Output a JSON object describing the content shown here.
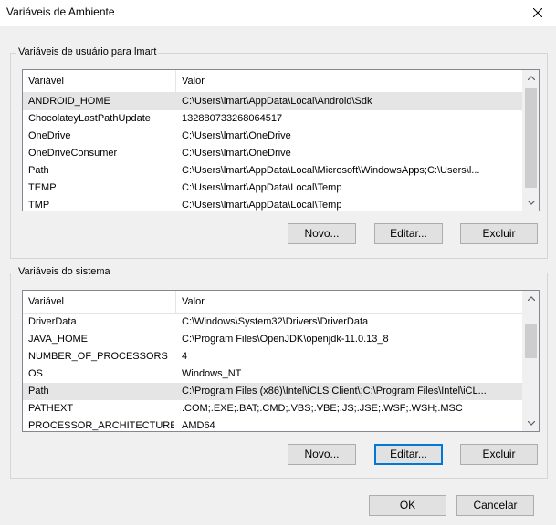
{
  "window": {
    "title": "Variáveis de Ambiente"
  },
  "user_group": {
    "legend": "Variáveis de usuário para lmart",
    "columns": [
      "Variável",
      "Valor"
    ],
    "rows": [
      {
        "name": "ANDROID_HOME",
        "value": "C:\\Users\\lmart\\AppData\\Local\\Android\\Sdk",
        "selected": true
      },
      {
        "name": "ChocolateyLastPathUpdate",
        "value": "132880733268064517"
      },
      {
        "name": "OneDrive",
        "value": "C:\\Users\\lmart\\OneDrive"
      },
      {
        "name": "OneDriveConsumer",
        "value": "C:\\Users\\lmart\\OneDrive"
      },
      {
        "name": "Path",
        "value": "C:\\Users\\lmart\\AppData\\Local\\Microsoft\\WindowsApps;C:\\Users\\l..."
      },
      {
        "name": "TEMP",
        "value": "C:\\Users\\lmart\\AppData\\Local\\Temp"
      },
      {
        "name": "TMP",
        "value": "C:\\Users\\lmart\\AppData\\Local\\Temp"
      }
    ],
    "buttons": {
      "new": "Novo...",
      "edit": "Editar...",
      "delete": "Excluir"
    }
  },
  "system_group": {
    "legend": "Variáveis do sistema",
    "columns": [
      "Variável",
      "Valor"
    ],
    "rows": [
      {
        "name": "DriverData",
        "value": "C:\\Windows\\System32\\Drivers\\DriverData"
      },
      {
        "name": "JAVA_HOME",
        "value": "C:\\Program Files\\OpenJDK\\openjdk-11.0.13_8"
      },
      {
        "name": "NUMBER_OF_PROCESSORS",
        "value": "4"
      },
      {
        "name": "OS",
        "value": "Windows_NT"
      },
      {
        "name": "Path",
        "value": "C:\\Program Files (x86)\\Intel\\iCLS Client\\;C:\\Program Files\\Intel\\iCL...",
        "selected": true
      },
      {
        "name": "PATHEXT",
        "value": ".COM;.EXE;.BAT;.CMD;.VBS;.VBE;.JS;.JSE;.WSF;.WSH;.MSC"
      },
      {
        "name": "PROCESSOR_ARCHITECTURE",
        "value": "AMD64"
      }
    ],
    "buttons": {
      "new": "Novo...",
      "edit": "Editar...",
      "delete": "Excluir"
    }
  },
  "footer": {
    "ok": "OK",
    "cancel": "Cancelar"
  },
  "icons": {
    "close": "close-icon",
    "scroll_up": "chevron-up-icon",
    "scroll_down": "chevron-down-icon"
  },
  "colors": {
    "selection": "#e5e5e5",
    "focus_border": "#0078d7",
    "button_bg": "#e1e1e1"
  }
}
